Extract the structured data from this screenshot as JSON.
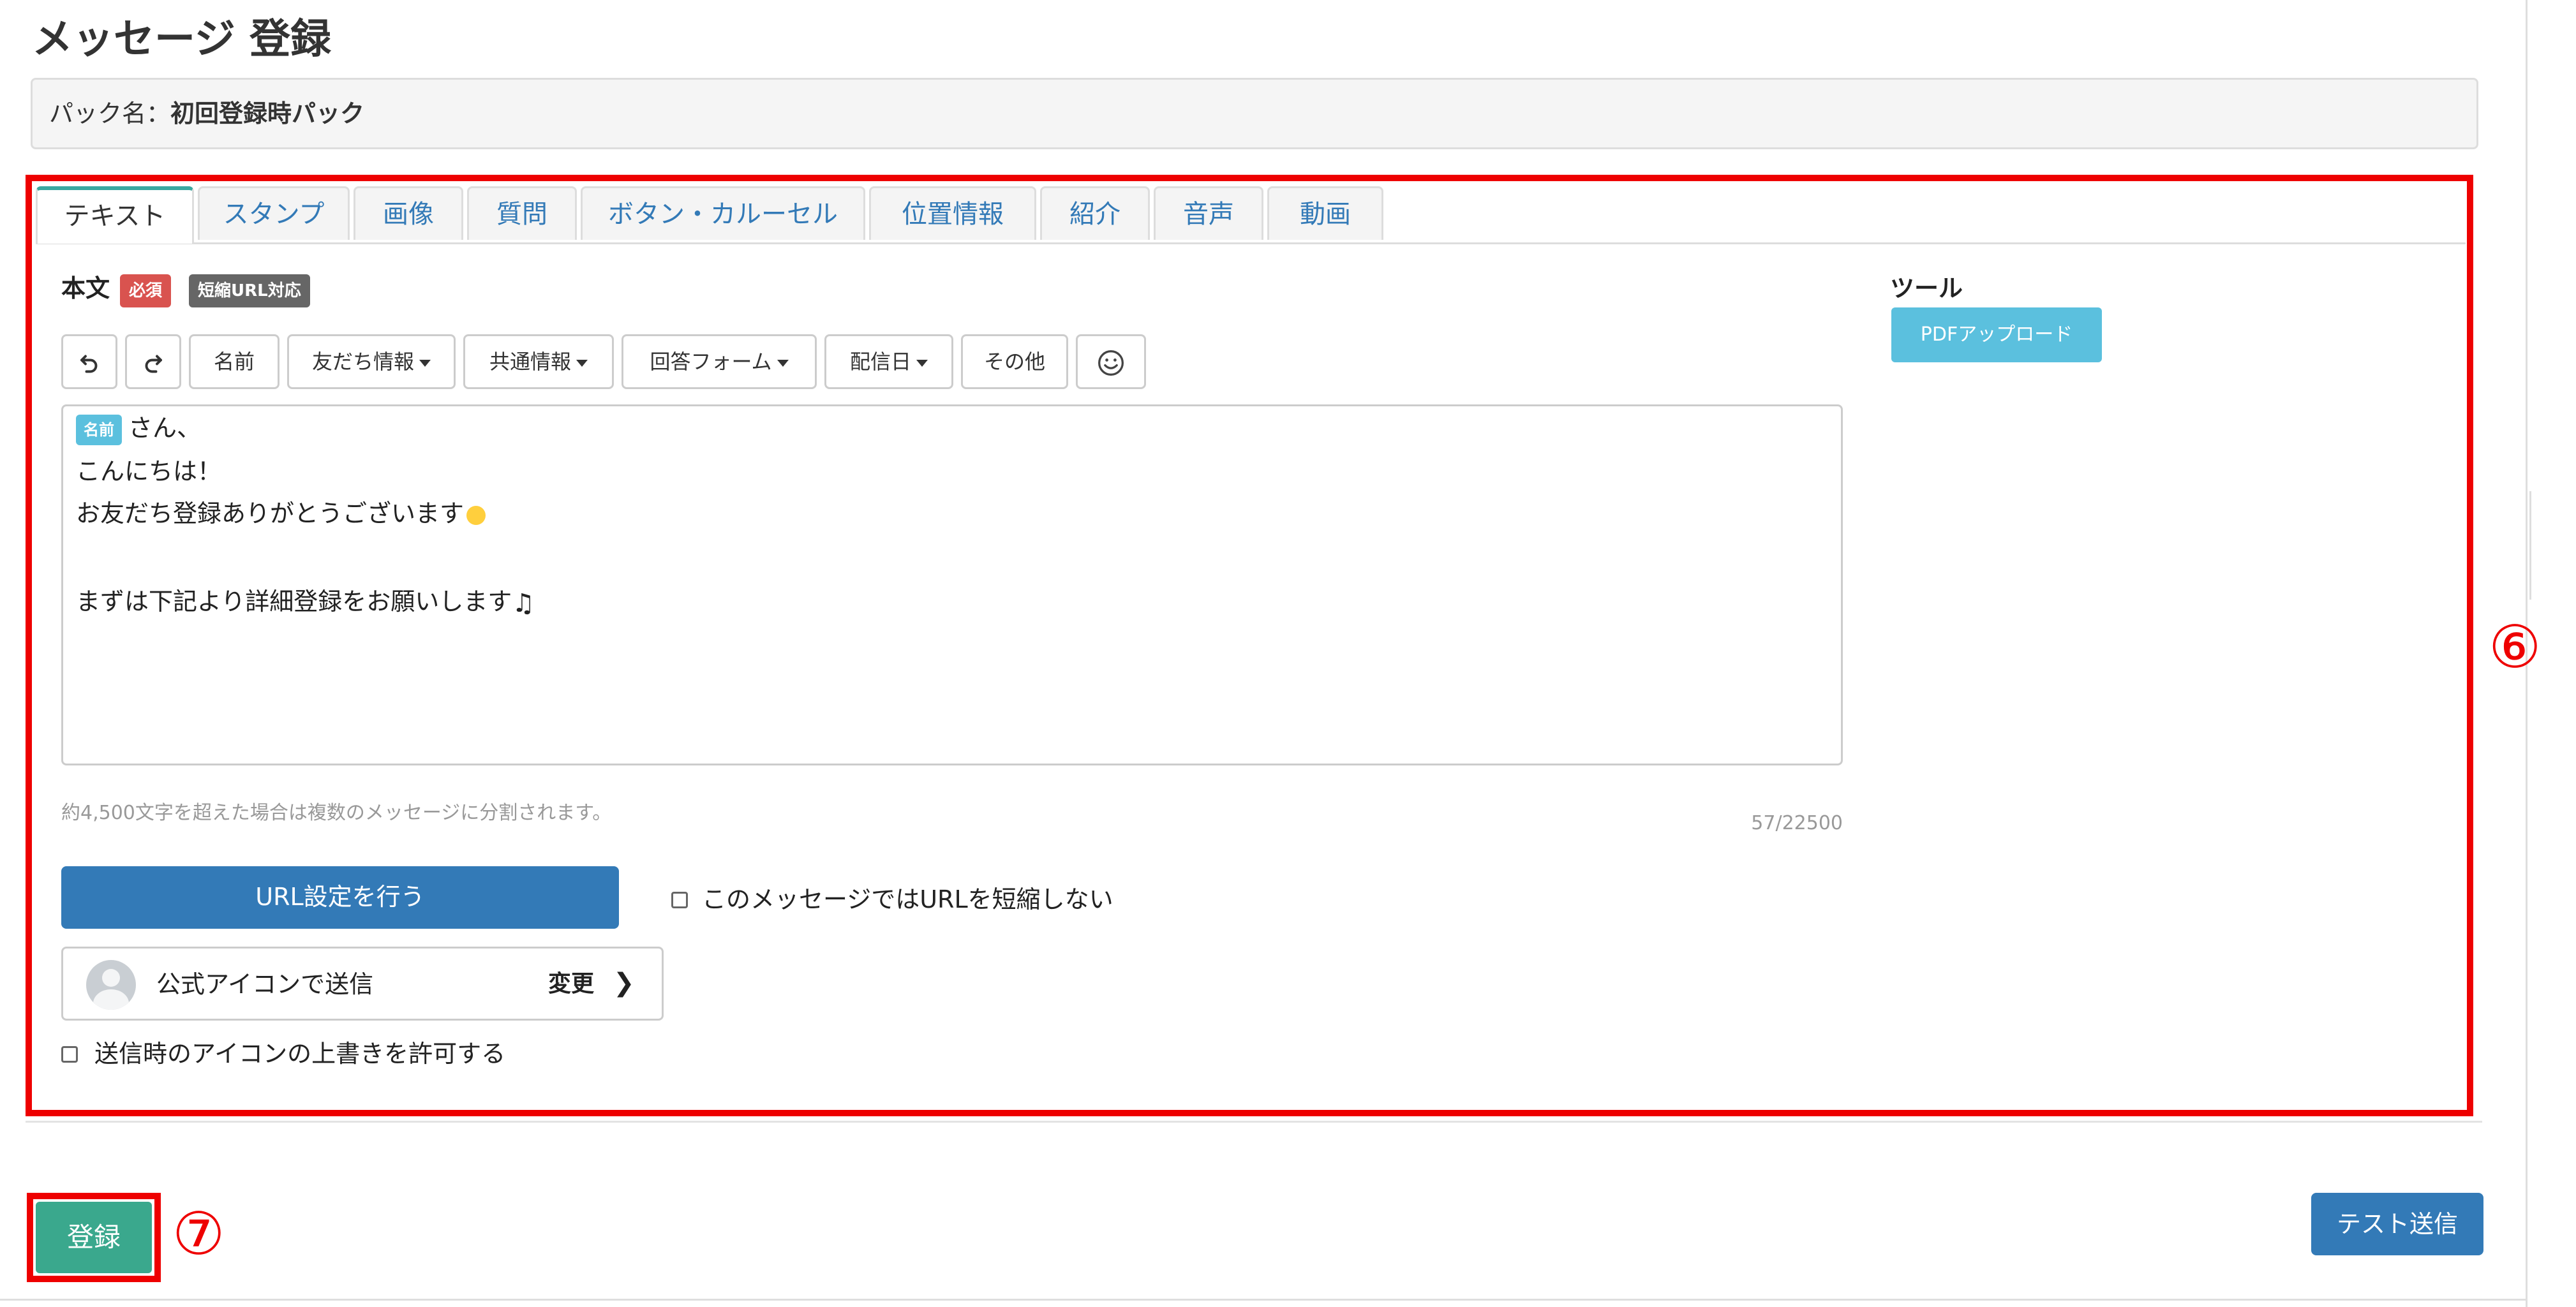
{
  "page": {
    "title": "メッセージ 登録",
    "pack_label": "パック名：",
    "pack_name": "初回登録時パック"
  },
  "tabs": [
    {
      "label": "テキスト",
      "active": true
    },
    {
      "label": "スタンプ"
    },
    {
      "label": "画像"
    },
    {
      "label": "質問"
    },
    {
      "label": "ボタン・カルーセル"
    },
    {
      "label": "位置情報"
    },
    {
      "label": "紹介"
    },
    {
      "label": "音声"
    },
    {
      "label": "動画"
    }
  ],
  "body": {
    "label": "本文",
    "required_badge": "必須",
    "short_url_badge": "短縮URL対応"
  },
  "toolbar": {
    "undo_icon": "undo-icon",
    "redo_icon": "redo-icon",
    "name": "名前",
    "friend_info": "友だち情報",
    "common_info": "共通情報",
    "answer_form": "回答フォーム",
    "delivery_date": "配信日",
    "other": "その他",
    "emoji_icon": "smiley-icon"
  },
  "editor": {
    "name_tag": "名前",
    "line1_suffix": "さん、",
    "line2": "こんにちは！",
    "line3": "お友だち登録ありがとうございます",
    "line4": "まずは下記より詳細登録をお願いします",
    "emoji_face": "😆",
    "emoji_note": "♫"
  },
  "hint": "約4,500文字を超えた場合は複数のメッセージに分割されます。",
  "counter": "57/22500",
  "url_button": "URL設定を行う",
  "no_shorten_label": "このメッセージではURLを短縮しない",
  "icon_send": {
    "label": "公式アイコンで送信",
    "change": "変更",
    "chevron": "❯"
  },
  "allow_override_label": "送信時のアイコンの上書きを許可する",
  "tools": {
    "heading": "ツール",
    "pdf_upload": "PDFアップロード"
  },
  "footer": {
    "submit": "登録",
    "test_send": "テスト送信"
  },
  "annotations": {
    "six": "⑥",
    "seven": "⑦"
  },
  "colors": {
    "highlight": "#ee0000",
    "primary": "#337ab7",
    "submit": "#3aa88d",
    "info": "#5bc0de",
    "danger": "#d9534f"
  }
}
